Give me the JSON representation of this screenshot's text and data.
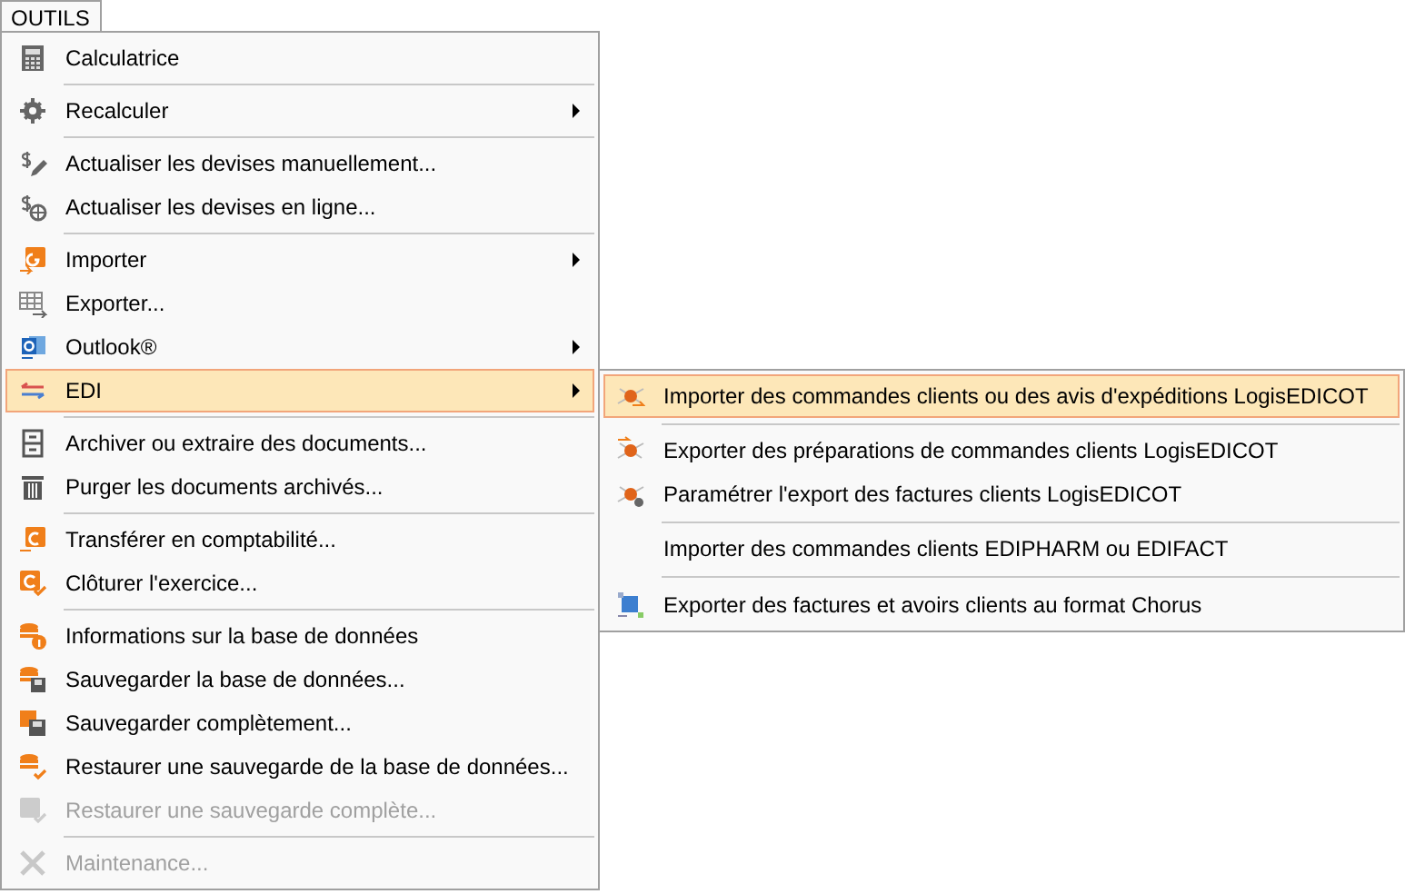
{
  "menu_bar": {
    "label": "OUTILS",
    "selected": true
  },
  "menu": [
    {
      "kind": "item",
      "label": "Calculatrice",
      "submenu": false,
      "disabled": false,
      "selected": false
    },
    {
      "kind": "separator"
    },
    {
      "kind": "item",
      "label": "Recalculer",
      "submenu": true,
      "disabled": false,
      "selected": false
    },
    {
      "kind": "separator"
    },
    {
      "kind": "item",
      "label": "Actualiser les devises manuellement...",
      "submenu": false,
      "disabled": false,
      "selected": false
    },
    {
      "kind": "item",
      "label": "Actualiser les devises en ligne...",
      "submenu": false,
      "disabled": false,
      "selected": false
    },
    {
      "kind": "separator"
    },
    {
      "kind": "item",
      "label": "Importer",
      "submenu": true,
      "disabled": false,
      "selected": false
    },
    {
      "kind": "item",
      "label": "Exporter...",
      "submenu": false,
      "disabled": false,
      "selected": false
    },
    {
      "kind": "item",
      "label": "Outlook®",
      "submenu": true,
      "disabled": false,
      "selected": false
    },
    {
      "kind": "item",
      "label": "EDI",
      "submenu": true,
      "disabled": false,
      "selected": true
    },
    {
      "kind": "separator"
    },
    {
      "kind": "item",
      "label": "Archiver ou extraire des documents...",
      "submenu": false,
      "disabled": false,
      "selected": false
    },
    {
      "kind": "item",
      "label": "Purger les documents archivés...",
      "submenu": false,
      "disabled": false,
      "selected": false
    },
    {
      "kind": "separator"
    },
    {
      "kind": "item",
      "label": "Transférer en comptabilité...",
      "submenu": false,
      "disabled": false,
      "selected": false
    },
    {
      "kind": "item",
      "label": "Clôturer l'exercice...",
      "submenu": false,
      "disabled": false,
      "selected": false
    },
    {
      "kind": "separator"
    },
    {
      "kind": "item",
      "label": "Informations sur la base de données",
      "submenu": false,
      "disabled": false,
      "selected": false
    },
    {
      "kind": "item",
      "label": "Sauvegarder la base de données...",
      "submenu": false,
      "disabled": false,
      "selected": false
    },
    {
      "kind": "item",
      "label": "Sauvegarder complètement...",
      "submenu": false,
      "disabled": false,
      "selected": false
    },
    {
      "kind": "item",
      "label": "Restaurer une sauvegarde de la base de données...",
      "submenu": false,
      "disabled": false,
      "selected": false
    },
    {
      "kind": "item",
      "label": "Restaurer une sauvegarde complète...",
      "submenu": false,
      "disabled": true,
      "selected": false
    },
    {
      "kind": "separator"
    },
    {
      "kind": "item",
      "label": "Maintenance...",
      "submenu": false,
      "disabled": true,
      "selected": false
    }
  ],
  "submenu": [
    {
      "kind": "item",
      "label": "Importer des commandes clients ou des avis d'expéditions LogisEDICOT",
      "selected": true
    },
    {
      "kind": "separator"
    },
    {
      "kind": "item",
      "label": "Exporter des préparations de commandes clients LogisEDICOT",
      "selected": false
    },
    {
      "kind": "item",
      "label": "Paramétrer l'export des factures clients LogisEDICOT",
      "selected": false
    },
    {
      "kind": "separator"
    },
    {
      "kind": "item",
      "label": "Importer des commandes clients EDIPHARM ou EDIFACT",
      "selected": false
    },
    {
      "kind": "separator"
    },
    {
      "kind": "item",
      "label": "Exporter des factures et avoirs clients au format Chorus",
      "selected": false
    }
  ]
}
